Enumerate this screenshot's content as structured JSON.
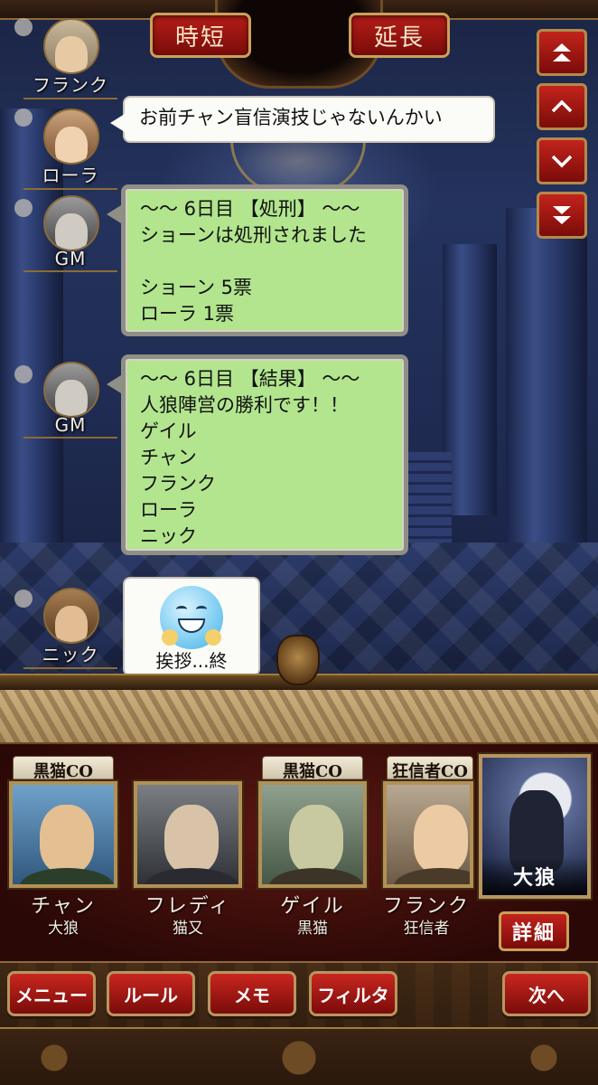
{
  "header": {
    "left_button": "時短",
    "right_button": "延長"
  },
  "scroll": {
    "icons": [
      "double-up-arrow-icon",
      "up-arrow-icon",
      "down-arrow-icon",
      "double-down-arrow-icon"
    ]
  },
  "chat": [
    {
      "speaker": "フランク",
      "lines": []
    },
    {
      "speaker": "ローラ",
      "lines": [
        "お前チャン盲信演技じゃないんかい"
      ]
    },
    {
      "speaker": "GM",
      "lines": [
        "～～ 6日目 【処刑】 ～～",
        "ショーンは処刑されました",
        "",
        "ショーン 5票",
        "ローラ 1票"
      ]
    },
    {
      "speaker": "GM",
      "lines": [
        "～～ 6日目 【結果】 ～～",
        "人狼陣営の勝利です！！",
        "ゲイル",
        "チャン",
        "フランク",
        "ローラ",
        "ニック"
      ]
    },
    {
      "speaker": "ニック",
      "stamp_caption": "挨拶...終",
      "stamp_icon": "grinning-face-icon"
    }
  ],
  "players": [
    {
      "co": "黒猫CO",
      "name": "チャン",
      "role": "大狼",
      "accent": "#c82a22"
    },
    {
      "co": "",
      "name": "フレディ",
      "role": "猫又",
      "accent": "#3a8ee0"
    },
    {
      "co": "黒猫CO",
      "name": "ゲイル",
      "role": "黒猫",
      "accent": "#c82a22"
    },
    {
      "co": "狂信者CO",
      "name": "フランク",
      "role": "狂信者",
      "accent": "#c82a22"
    }
  ],
  "my_role": {
    "label": "大狼",
    "detail_button": "詳細"
  },
  "footer": {
    "menu": "メニュー",
    "rules": "ルール",
    "memo": "メモ",
    "filter": "フィルタ",
    "next": "次へ"
  },
  "colors": {
    "button_red": "#b51d18",
    "gold_border": "#caa05a",
    "bubble_green": "#b2e58e"
  }
}
